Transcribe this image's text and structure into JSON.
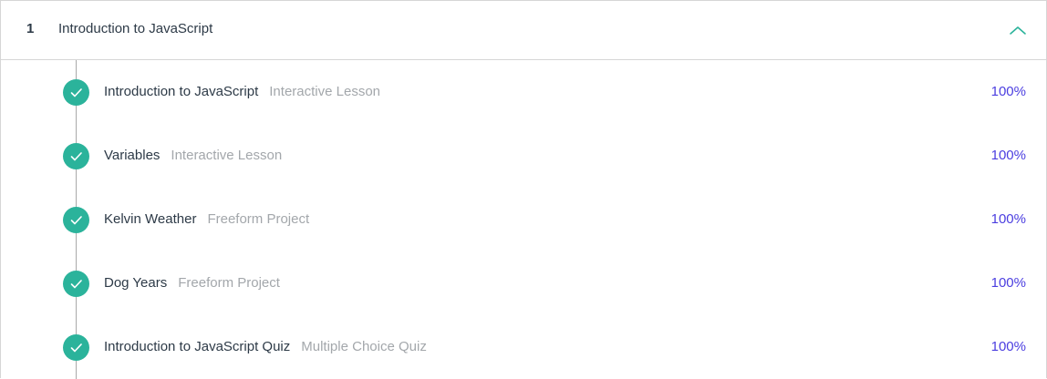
{
  "module": {
    "number": "1",
    "title": "Introduction to JavaScript",
    "expanded": true,
    "chevron_icon": "chevron-up-icon",
    "accent_color": "#2bb39b"
  },
  "lessons": [
    {
      "name": "Introduction to JavaScript",
      "type": "Interactive Lesson",
      "progress": "100%",
      "status_icon": "check-circle-icon"
    },
    {
      "name": "Variables",
      "type": "Interactive Lesson",
      "progress": "100%",
      "status_icon": "check-circle-icon"
    },
    {
      "name": "Kelvin Weather",
      "type": "Freeform Project",
      "progress": "100%",
      "status_icon": "check-circle-icon"
    },
    {
      "name": "Dog Years",
      "type": "Freeform Project",
      "progress": "100%",
      "status_icon": "check-circle-icon"
    },
    {
      "name": "Introduction to JavaScript Quiz",
      "type": "Multiple Choice Quiz",
      "progress": "100%",
      "status_icon": "check-circle-icon"
    }
  ],
  "colors": {
    "complete": "#2bb39b",
    "progress_text": "#4b3ee0",
    "title_text": "#2d3a47",
    "subtle_text": "#a3a7ab"
  }
}
